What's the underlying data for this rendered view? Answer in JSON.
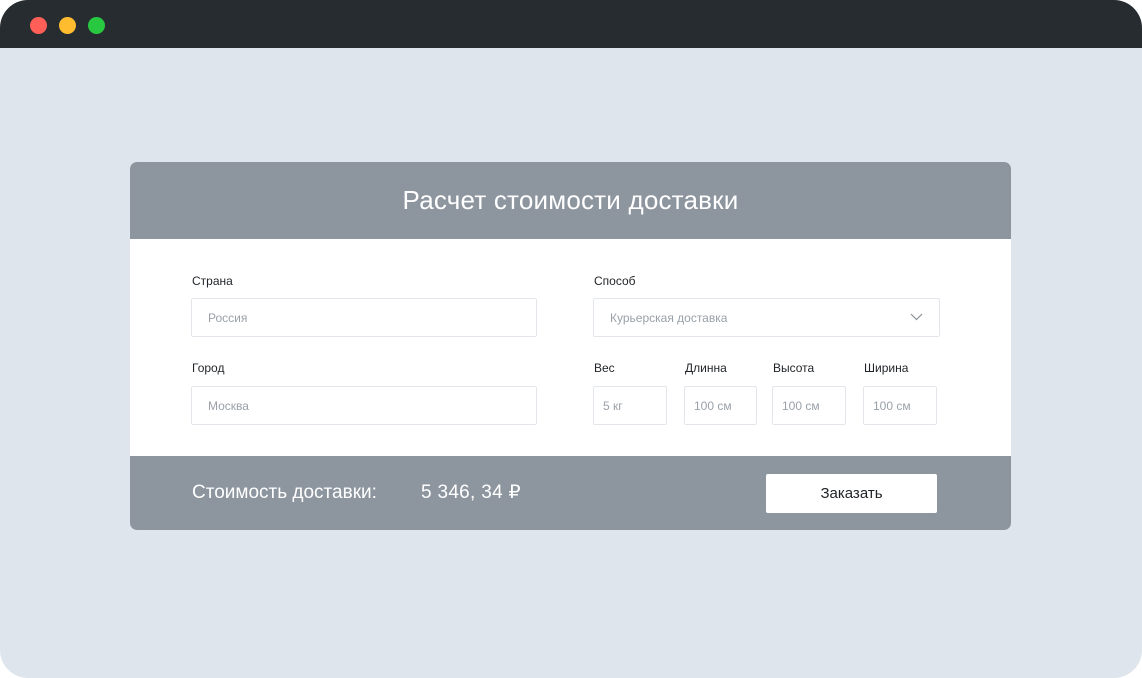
{
  "window": {
    "controls": [
      "close",
      "minimize",
      "maximize"
    ]
  },
  "card": {
    "title": "Расчет стоимости доставки",
    "fields": {
      "country": {
        "label": "Страна",
        "value": "Россия"
      },
      "city": {
        "label": "Город",
        "value": "Москва"
      },
      "method": {
        "label": "Способ",
        "value": "Курьерская доставка"
      },
      "weight": {
        "label": "Вес",
        "value": "5 кг"
      },
      "length": {
        "label": "Длинна",
        "value": "100 см"
      },
      "height": {
        "label": "Высота",
        "value": "100 см"
      },
      "width": {
        "label": "Ширина",
        "value": "100 см"
      }
    },
    "footer": {
      "cost_label": "Стоимость доставки:",
      "cost_value": "5 346, 34 ₽",
      "order_label": "Заказать"
    }
  },
  "colors": {
    "background": "#dfe5ec",
    "titlebar": "#262c30",
    "card_header": "#8d959f",
    "close": "#ff5f57",
    "minimize": "#febc2e",
    "maximize": "#28c840"
  },
  "icons": {
    "method_dropdown": "chevron-down-icon"
  }
}
